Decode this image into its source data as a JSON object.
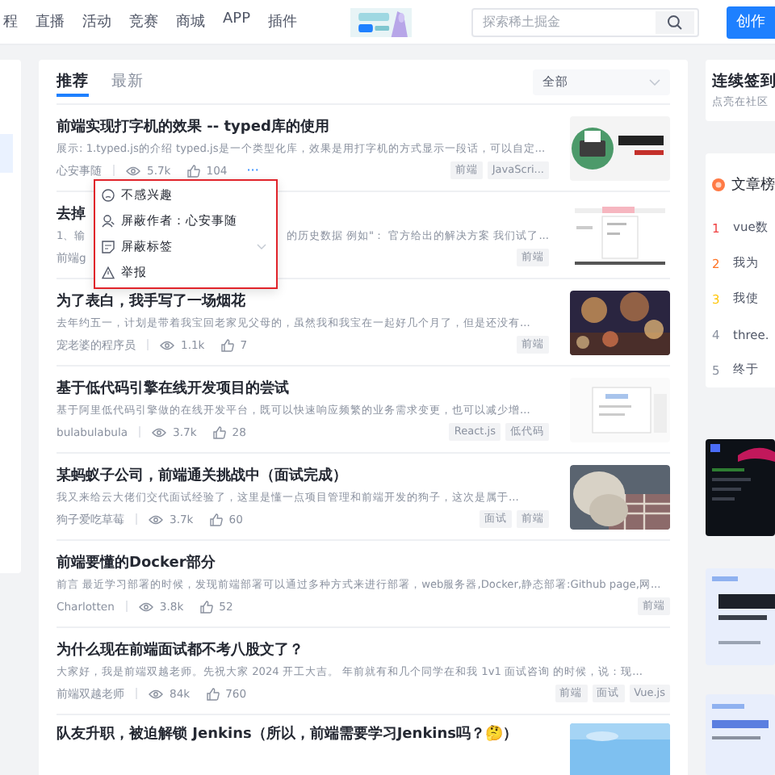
{
  "nav": {
    "items": [
      {
        "label": "程"
      },
      {
        "label": "直播"
      },
      {
        "label": "活动"
      },
      {
        "label": "竞赛"
      },
      {
        "label": "商城"
      },
      {
        "label": "APP"
      },
      {
        "label": "插件"
      }
    ],
    "banner": {
      "kind": "picture"
    },
    "search": {
      "placeholder": "探索稀土掘金"
    },
    "create_button": "创作"
  },
  "feed": {
    "tabs": [
      {
        "label": "推荐",
        "selected": true
      },
      {
        "label": "最新",
        "selected": false
      }
    ],
    "filter": "全部",
    "articles": [
      {
        "title": "前端实现打字机的效果 -- typed库的使用",
        "summary": "展示: 1.typed.js的介绍 typed.js是一个类型化库，效果是用打字机的方式显示一段话，可以自定...",
        "author": "心安事随",
        "views": "5.7k",
        "likes": "104",
        "more": "···",
        "tags": [
          "前端",
          "JavaScri..."
        ],
        "thumbnail": {
          "kind": "picture"
        }
      },
      {
        "title": "去掉",
        "summary_parts": [
          "1、输",
          "的历史数据 例如\"：  官方给出的解决方案 我们试了..."
        ],
        "author": "前端g",
        "tags": [
          "前端"
        ],
        "thumbnail": {
          "kind": "picture"
        }
      },
      {
        "title": "为了表白，我手写了一场烟花",
        "summary": "去年约五一，计划是带着我宝回老家见父母的，虽然我和我宝在一起好几个月了，但是还没有...",
        "author": "宠老婆的程序员",
        "views": "1.1k",
        "likes": "7",
        "tags": [
          "前端"
        ],
        "thumbnail": {
          "kind": "picture"
        }
      },
      {
        "title": "基于低代码引擎在线开发项目的尝试",
        "summary": "基于阿里低代码引擎做的在线开发平台，既可以快速响应频繁的业务需求变更，也可以减少增...",
        "author": "bulabulabula",
        "views": "3.7k",
        "likes": "28",
        "tags": [
          "React.js",
          "低代码"
        ],
        "thumbnail": {
          "kind": "picture"
        }
      },
      {
        "title": "某蚂蚁子公司，前端通关挑战中（面试完成）",
        "summary": "我又来给云大佬们交代面试经验了，这里是懂一点项目管理和前端开发的狗子，这次是属于...",
        "author": "狗子爱吃草莓",
        "views": "3.7k",
        "likes": "60",
        "tags": [
          "面试",
          "前端"
        ],
        "thumbnail": {
          "kind": "picture"
        }
      },
      {
        "title": "前端要懂的Docker部分",
        "summary": "前言 最近学习部署的时候，发现前端部署可以通过多种方式来进行部署，web服务器,Docker,静态部署:Github page,网...",
        "author": "Charlotten",
        "views": "3.8k",
        "likes": "52",
        "tags": [
          "前端"
        ]
      },
      {
        "title": "为什么现在前端面试都不考八股文了？",
        "summary": "大家好，我是前端双越老师。先祝大家 2024 开工大吉。 年前就有和几个同学在和我 1v1 面试咨询 的时候，说：现...",
        "author": "前端双越老师",
        "views": "84k",
        "likes": "760",
        "tags": [
          "前端",
          "面试",
          "Vue.js"
        ]
      },
      {
        "title": "队友升职，被迫解锁 Jenkins（所以，前端需要学习Jenkins吗？🤔）",
        "thumbnail": {
          "kind": "picture"
        }
      }
    ]
  },
  "context_menu": {
    "items": [
      {
        "label": "不感兴趣",
        "kind": "dislike"
      },
      {
        "label": "屏蔽作者：心安事随",
        "kind": "block-author"
      },
      {
        "label": "屏蔽标签",
        "kind": "block-tag",
        "expandable": true
      },
      {
        "label": "举报",
        "kind": "report"
      }
    ]
  },
  "sidebar": {
    "checkin": {
      "title": "连续签到",
      "subtitle": "点亮在社区"
    },
    "ranking": {
      "title": "文章榜",
      "items": [
        {
          "rank": "1",
          "title": "vue数",
          "color": "#f04142"
        },
        {
          "rank": "2",
          "title": "我为",
          "color": "#ff7426"
        },
        {
          "rank": "3",
          "title": "我使",
          "color": "#ffc60a"
        },
        {
          "rank": "4",
          "title": "three.",
          "color": "#8a919f"
        },
        {
          "rank": "5",
          "title": "终于",
          "color": "#8a919f"
        }
      ]
    },
    "ads": [
      {
        "kind": "picture"
      },
      {
        "kind": "picture"
      },
      {
        "kind": "picture"
      }
    ]
  }
}
